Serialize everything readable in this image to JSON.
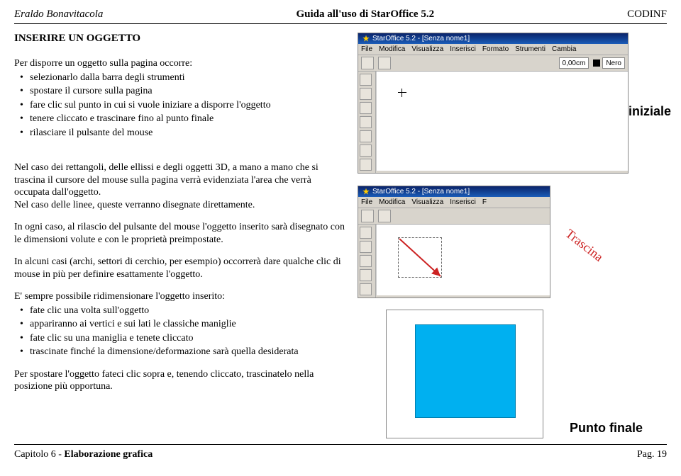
{
  "header": {
    "left": "Eraldo Bonavitacola",
    "center": "Guida all'uso di StarOffice 5.2",
    "right": "CODINF"
  },
  "section_title": "INSERIRE UN OGGETTO",
  "intro": "Per disporre un oggetto sulla pagina occorre:",
  "steps1": [
    "selezionarlo dalla barra degli strumenti",
    "spostare il cursore sulla pagina",
    "fare clic sul punto in cui si vuole iniziare a disporre l'oggetto",
    "tenere cliccato e trascinare fino al punto finale",
    "rilasciare il pulsante del mouse"
  ],
  "para2": "Nel caso dei rettangoli, delle ellissi e degli oggetti 3D, a mano a mano che si trascina il cursore del mouse sulla pagina verrà evidenziata l'area che verrà occupata dall'oggetto.",
  "para2b": "Nel caso delle linee, queste verranno disegnate direttamente.",
  "para3": "In ogni caso, al rilascio del pulsante del mouse l'oggetto inserito sarà disegnato con le dimensioni volute e con le proprietà preimpostate.",
  "para4": "In alcuni casi (archi, settori di cerchio, per esempio) occorrerà dare qualche clic di mouse in più per definire esattamente l'oggetto.",
  "para5": "E' sempre possibile  ridimensionare l'oggetto inserito:",
  "steps2": [
    "fate clic una volta sull'oggetto",
    "appariranno ai vertici e sui lati le classiche maniglie",
    "fate clic su una maniglia e tenete cliccato",
    "trascinate finché la dimensione/deformazione sarà quella desiderata"
  ],
  "para6": "Per spostare l'oggetto fateci clic sopra e, tenendo cliccato, trascinatelo nella posizione più opportuna.",
  "footer": {
    "left_a": "Capitolo 6 - ",
    "left_b": "Elaborazione grafica",
    "right": "Pag. 19"
  },
  "screenshot": {
    "app_title": "StarOffice 5.2 - [Senza nome1]",
    "menus_full": [
      "File",
      "Modifica",
      "Visualizza",
      "Inserisci",
      "Formato",
      "Strumenti",
      "Cambia"
    ],
    "menus_short": [
      "File",
      "Modifica",
      "Visualizza",
      "Inserisci",
      "F"
    ],
    "coord": "0,00cm",
    "color": "Nero",
    "label_start": "Punto iniziale",
    "label_drag": "Trascina",
    "label_end": "Punto finale"
  }
}
